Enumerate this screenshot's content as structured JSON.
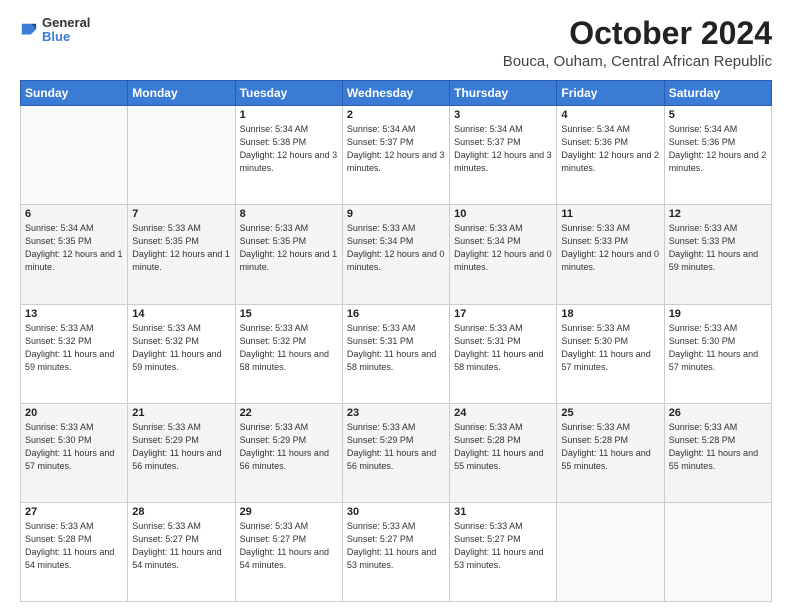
{
  "header": {
    "logo_general": "General",
    "logo_blue": "Blue",
    "month_title": "October 2024",
    "subtitle": "Bouca, Ouham, Central African Republic"
  },
  "days_of_week": [
    "Sunday",
    "Monday",
    "Tuesday",
    "Wednesday",
    "Thursday",
    "Friday",
    "Saturday"
  ],
  "weeks": [
    [
      {
        "day": "",
        "sunrise": "",
        "sunset": "",
        "daylight": "",
        "empty": true
      },
      {
        "day": "",
        "sunrise": "",
        "sunset": "",
        "daylight": "",
        "empty": true
      },
      {
        "day": "1",
        "sunrise": "Sunrise: 5:34 AM",
        "sunset": "Sunset: 5:38 PM",
        "daylight": "Daylight: 12 hours and 3 minutes.",
        "empty": false
      },
      {
        "day": "2",
        "sunrise": "Sunrise: 5:34 AM",
        "sunset": "Sunset: 5:37 PM",
        "daylight": "Daylight: 12 hours and 3 minutes.",
        "empty": false
      },
      {
        "day": "3",
        "sunrise": "Sunrise: 5:34 AM",
        "sunset": "Sunset: 5:37 PM",
        "daylight": "Daylight: 12 hours and 3 minutes.",
        "empty": false
      },
      {
        "day": "4",
        "sunrise": "Sunrise: 5:34 AM",
        "sunset": "Sunset: 5:36 PM",
        "daylight": "Daylight: 12 hours and 2 minutes.",
        "empty": false
      },
      {
        "day": "5",
        "sunrise": "Sunrise: 5:34 AM",
        "sunset": "Sunset: 5:36 PM",
        "daylight": "Daylight: 12 hours and 2 minutes.",
        "empty": false
      }
    ],
    [
      {
        "day": "6",
        "sunrise": "Sunrise: 5:34 AM",
        "sunset": "Sunset: 5:35 PM",
        "daylight": "Daylight: 12 hours and 1 minute.",
        "empty": false
      },
      {
        "day": "7",
        "sunrise": "Sunrise: 5:33 AM",
        "sunset": "Sunset: 5:35 PM",
        "daylight": "Daylight: 12 hours and 1 minute.",
        "empty": false
      },
      {
        "day": "8",
        "sunrise": "Sunrise: 5:33 AM",
        "sunset": "Sunset: 5:35 PM",
        "daylight": "Daylight: 12 hours and 1 minute.",
        "empty": false
      },
      {
        "day": "9",
        "sunrise": "Sunrise: 5:33 AM",
        "sunset": "Sunset: 5:34 PM",
        "daylight": "Daylight: 12 hours and 0 minutes.",
        "empty": false
      },
      {
        "day": "10",
        "sunrise": "Sunrise: 5:33 AM",
        "sunset": "Sunset: 5:34 PM",
        "daylight": "Daylight: 12 hours and 0 minutes.",
        "empty": false
      },
      {
        "day": "11",
        "sunrise": "Sunrise: 5:33 AM",
        "sunset": "Sunset: 5:33 PM",
        "daylight": "Daylight: 12 hours and 0 minutes.",
        "empty": false
      },
      {
        "day": "12",
        "sunrise": "Sunrise: 5:33 AM",
        "sunset": "Sunset: 5:33 PM",
        "daylight": "Daylight: 11 hours and 59 minutes.",
        "empty": false
      }
    ],
    [
      {
        "day": "13",
        "sunrise": "Sunrise: 5:33 AM",
        "sunset": "Sunset: 5:32 PM",
        "daylight": "Daylight: 11 hours and 59 minutes.",
        "empty": false
      },
      {
        "day": "14",
        "sunrise": "Sunrise: 5:33 AM",
        "sunset": "Sunset: 5:32 PM",
        "daylight": "Daylight: 11 hours and 59 minutes.",
        "empty": false
      },
      {
        "day": "15",
        "sunrise": "Sunrise: 5:33 AM",
        "sunset": "Sunset: 5:32 PM",
        "daylight": "Daylight: 11 hours and 58 minutes.",
        "empty": false
      },
      {
        "day": "16",
        "sunrise": "Sunrise: 5:33 AM",
        "sunset": "Sunset: 5:31 PM",
        "daylight": "Daylight: 11 hours and 58 minutes.",
        "empty": false
      },
      {
        "day": "17",
        "sunrise": "Sunrise: 5:33 AM",
        "sunset": "Sunset: 5:31 PM",
        "daylight": "Daylight: 11 hours and 58 minutes.",
        "empty": false
      },
      {
        "day": "18",
        "sunrise": "Sunrise: 5:33 AM",
        "sunset": "Sunset: 5:30 PM",
        "daylight": "Daylight: 11 hours and 57 minutes.",
        "empty": false
      },
      {
        "day": "19",
        "sunrise": "Sunrise: 5:33 AM",
        "sunset": "Sunset: 5:30 PM",
        "daylight": "Daylight: 11 hours and 57 minutes.",
        "empty": false
      }
    ],
    [
      {
        "day": "20",
        "sunrise": "Sunrise: 5:33 AM",
        "sunset": "Sunset: 5:30 PM",
        "daylight": "Daylight: 11 hours and 57 minutes.",
        "empty": false
      },
      {
        "day": "21",
        "sunrise": "Sunrise: 5:33 AM",
        "sunset": "Sunset: 5:29 PM",
        "daylight": "Daylight: 11 hours and 56 minutes.",
        "empty": false
      },
      {
        "day": "22",
        "sunrise": "Sunrise: 5:33 AM",
        "sunset": "Sunset: 5:29 PM",
        "daylight": "Daylight: 11 hours and 56 minutes.",
        "empty": false
      },
      {
        "day": "23",
        "sunrise": "Sunrise: 5:33 AM",
        "sunset": "Sunset: 5:29 PM",
        "daylight": "Daylight: 11 hours and 56 minutes.",
        "empty": false
      },
      {
        "day": "24",
        "sunrise": "Sunrise: 5:33 AM",
        "sunset": "Sunset: 5:28 PM",
        "daylight": "Daylight: 11 hours and 55 minutes.",
        "empty": false
      },
      {
        "day": "25",
        "sunrise": "Sunrise: 5:33 AM",
        "sunset": "Sunset: 5:28 PM",
        "daylight": "Daylight: 11 hours and 55 minutes.",
        "empty": false
      },
      {
        "day": "26",
        "sunrise": "Sunrise: 5:33 AM",
        "sunset": "Sunset: 5:28 PM",
        "daylight": "Daylight: 11 hours and 55 minutes.",
        "empty": false
      }
    ],
    [
      {
        "day": "27",
        "sunrise": "Sunrise: 5:33 AM",
        "sunset": "Sunset: 5:28 PM",
        "daylight": "Daylight: 11 hours and 54 minutes.",
        "empty": false
      },
      {
        "day": "28",
        "sunrise": "Sunrise: 5:33 AM",
        "sunset": "Sunset: 5:27 PM",
        "daylight": "Daylight: 11 hours and 54 minutes.",
        "empty": false
      },
      {
        "day": "29",
        "sunrise": "Sunrise: 5:33 AM",
        "sunset": "Sunset: 5:27 PM",
        "daylight": "Daylight: 11 hours and 54 minutes.",
        "empty": false
      },
      {
        "day": "30",
        "sunrise": "Sunrise: 5:33 AM",
        "sunset": "Sunset: 5:27 PM",
        "daylight": "Daylight: 11 hours and 53 minutes.",
        "empty": false
      },
      {
        "day": "31",
        "sunrise": "Sunrise: 5:33 AM",
        "sunset": "Sunset: 5:27 PM",
        "daylight": "Daylight: 11 hours and 53 minutes.",
        "empty": false
      },
      {
        "day": "",
        "sunrise": "",
        "sunset": "",
        "daylight": "",
        "empty": true
      },
      {
        "day": "",
        "sunrise": "",
        "sunset": "",
        "daylight": "",
        "empty": true
      }
    ]
  ]
}
